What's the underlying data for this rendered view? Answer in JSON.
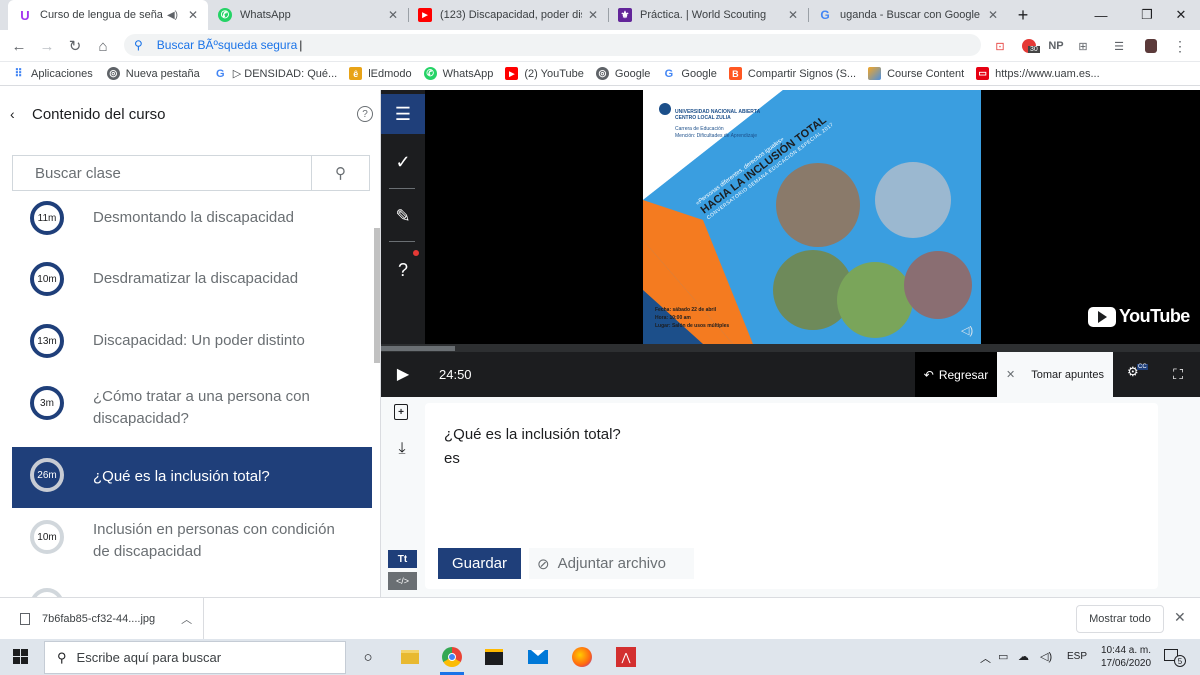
{
  "browser": {
    "tabs": [
      {
        "title": "Curso de lengua de señas",
        "icon": "udemy-icon",
        "color": "#a435f0",
        "active": true
      },
      {
        "title": "WhatsApp",
        "icon": "whatsapp-icon",
        "color": "#25d366"
      },
      {
        "title": "(123) Discapacidad, poder disti",
        "icon": "youtube-icon",
        "color": "#ff0000"
      },
      {
        "title": "Práctica. | World Scouting",
        "icon": "scouting-icon",
        "color": "#622599"
      },
      {
        "title": "uganda - Buscar con Google",
        "icon": "google-icon",
        "color": "#4285f4"
      }
    ],
    "new_tab": "+",
    "address": "Buscar BÃºsqueda segura",
    "extensions": {
      "np": "NP",
      "badge": "30"
    },
    "bookmarks": [
      {
        "label": "Aplicaciones",
        "icon": "apps-icon",
        "color": "#4285f4"
      },
      {
        "label": "Nueva pestaña",
        "icon": "chrome-icon",
        "color": "#5f6368"
      },
      {
        "label": "▷ DENSIDAD: Qué...",
        "icon": "google-icon",
        "color": "#4285f4"
      },
      {
        "label": "lEdmodo",
        "icon": "edmodo-icon",
        "color": "#e8a317"
      },
      {
        "label": "WhatsApp",
        "icon": "whatsapp-icon",
        "color": "#25d366"
      },
      {
        "label": "(2) YouTube",
        "icon": "youtube-icon",
        "color": "#ff0000"
      },
      {
        "label": "Google",
        "icon": "chrome-icon",
        "color": "#5f6368"
      },
      {
        "label": "Google",
        "icon": "google-icon",
        "color": "#4285f4"
      },
      {
        "label": "Compartir Signos (S...",
        "icon": "blogger-icon",
        "color": "#ff5722"
      },
      {
        "label": "Course Content",
        "icon": "course-icon",
        "color": "#f5a623"
      },
      {
        "label": "https://www.uam.es...",
        "icon": "uam-icon",
        "color": "#e60012"
      }
    ],
    "bookmarks_more": "»"
  },
  "sidebar": {
    "title": "Contenido del curso",
    "search_placeholder": "Buscar clase",
    "lessons": [
      {
        "duration": "11m",
        "title": "Desmontando la discapacidad"
      },
      {
        "duration": "10m",
        "title": "Desdramatizar la discapacidad"
      },
      {
        "duration": "13m",
        "title": "Discapacidad: Un poder distinto"
      },
      {
        "duration": "3m",
        "title": "¿Cómo tratar a una persona con discapacidad?"
      },
      {
        "duration": "26m",
        "title": "¿Qué es la inclusión total?",
        "active": true
      },
      {
        "duration": "10m",
        "title": "Inclusión en personas con condición de discapacidad"
      }
    ]
  },
  "video": {
    "slide": {
      "university": "UNIVERSIDAD NACIONAL ABIERTA",
      "center": "CENTRO LOCAL ZULIA",
      "career": "Carrera de Educación",
      "mention": "Mención: Dificultades de Aprendizaje",
      "tagline": "«Personas diferentes, derechos iguales»",
      "headline": "HACIA LA INCLUSIÓN TOTAL",
      "subheadline": "CONVERSATORIO SEMANA EDUCACIÓN ESPECIAL 2017",
      "date": "Fecha: sábado 22 de abril",
      "time": "Hora: 10:00 am",
      "place": "Lugar: Salón de usos múltiples"
    },
    "youtube_logo": "YouTube",
    "time": "24:50",
    "back_label": "Regresar",
    "notes_label": "Tomar apuntes",
    "progress": 0.09
  },
  "notes": {
    "question": "¿Qué es la inclusión total?",
    "answer": "es",
    "save_label": "Guardar",
    "attach_label": "Adjuntar archivo",
    "text_tool": "Tt",
    "code_tool": "</>"
  },
  "downloads": {
    "file": "7b6fab85-cf32-44....jpg",
    "show_all": "Mostrar todo"
  },
  "taskbar": {
    "search_placeholder": "Escribe aquí para buscar",
    "lang": "ESP",
    "time": "10:44 a. m.",
    "date": "17/06/2020",
    "notif_count": "5"
  }
}
